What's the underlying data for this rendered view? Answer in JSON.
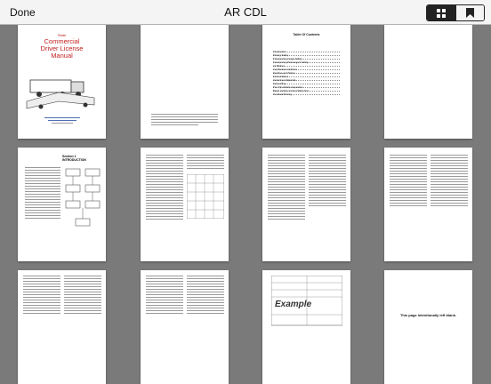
{
  "toolbar": {
    "done_label": "Done",
    "title": "AR CDL",
    "view_thumbnails_icon": "grid-icon",
    "bookmarks_icon": "bookmark-icon"
  },
  "pages": {
    "cover": {
      "state": "State",
      "title_line1": "Commercial",
      "title_line2": "Driver License",
      "title_line3": "Manual"
    },
    "toc": {
      "heading": "Table Of Contents",
      "items": [
        "Introduction",
        "Driving Safely",
        "Transporting Cargo Safely",
        "Transporting Passengers Safely",
        "Air Brakes",
        "Combination Vehicles",
        "Doubles and Triples",
        "Tank Vehicles",
        "Hazardous Materials",
        "School Bus",
        "Pre-Trip Vehicle Inspection",
        "Basic Vehicle Control Skills Test",
        "On-Road Driving"
      ]
    },
    "section_heading": "Section 1 INTRODUCTION",
    "example_label": "Example",
    "blank_page_text": "This page intentionally left blank."
  }
}
